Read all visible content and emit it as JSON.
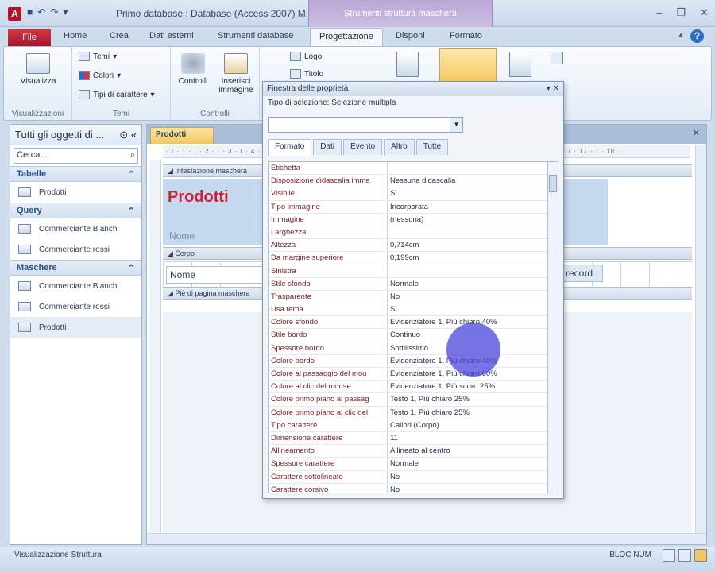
{
  "window": {
    "title": "Primo database : Database (Access 2007) M...",
    "tools_tab": "Strumenti struttura maschera"
  },
  "tabs": [
    {
      "label": "File"
    },
    {
      "label": "Home"
    },
    {
      "label": "Crea"
    },
    {
      "label": "Dati esterni"
    },
    {
      "label": "Strumenti database"
    },
    {
      "label": "Progettazione"
    },
    {
      "label": "Disponi"
    },
    {
      "label": "Formato"
    }
  ],
  "ribbon": {
    "visualizza": "Visualizza",
    "group_visualizzazioni": "Visualizzazioni",
    "temi": "Temi",
    "colori": "Colori",
    "tipi_carattere": "Tipi di carattere",
    "group_temi": "Temi",
    "controlli": "Controlli",
    "inserisci_immagine": "Inserisci immagine",
    "group_controlli": "Controlli",
    "logo": "Logo",
    "titolo": "Titolo"
  },
  "nav": {
    "header": "Tutti gli oggetti di ...",
    "search_placeholder": "Cerca...",
    "groups": [
      {
        "label": "Tabelle",
        "items": [
          "Prodotti"
        ]
      },
      {
        "label": "Query",
        "items": [
          "Commerciante Bianchi",
          "Commerciante rossi"
        ]
      },
      {
        "label": "Maschere",
        "items": [
          "Commerciante Bianchi",
          "Commerciante rossi",
          "Prodotti"
        ]
      }
    ]
  },
  "document": {
    "tab_label": "Prodotti",
    "header_section": "Intestazione maschera",
    "body_section": "Corpo",
    "footer_section": "Piè di pagina maschera",
    "form_title": "Prodotti",
    "header_field": "Nome",
    "body_field": "Nome",
    "record_button": "record"
  },
  "property_sheet": {
    "title": "Finestra delle proprietà",
    "selection_type": "Tipo di selezione:  Selezione multipla",
    "tabs": [
      "Formato",
      "Dati",
      "Evento",
      "Altro",
      "Tutte"
    ],
    "active_tab": "Formato",
    "rows": [
      [
        "Etichetta",
        ""
      ],
      [
        "Disposizione didascalia imma",
        "Nessuna didascalia"
      ],
      [
        "Visibile",
        "Sì"
      ],
      [
        "Tipo immagine",
        "Incorporata"
      ],
      [
        "Immagine",
        "(nessuna)"
      ],
      [
        "Larghezza",
        ""
      ],
      [
        "Altezza",
        "0,714cm"
      ],
      [
        "Da margine superiore",
        "0,199cm"
      ],
      [
        "Sinistra",
        ""
      ],
      [
        "Stile sfondo",
        "Normale"
      ],
      [
        "Trasparente",
        "No"
      ],
      [
        "Usa tema",
        "Sì"
      ],
      [
        "Colore sfondo",
        "Evidenziatore 1, Più chiaro 40%"
      ],
      [
        "Stile bordo",
        "Continuo"
      ],
      [
        "Spessore bordo",
        "Sottilissimo"
      ],
      [
        "Colore bordo",
        "Evidenziatore 1, Più chiaro 40%"
      ],
      [
        "Colore al passaggio del mou",
        "Evidenziatore 1, Più chiaro 60%"
      ],
      [
        "Colore al clic del mouse",
        "Evidenziatore 1, Più scuro 25%"
      ],
      [
        "Colore primo piano al passag",
        "Testo 1, Più chiaro 25%"
      ],
      [
        "Colore primo piano al clic del",
        "Testo 1, Più chiaro 25%"
      ],
      [
        "Tipo carattere",
        "Calibri (Corpo)"
      ],
      [
        "Dimensione carattere",
        "11"
      ],
      [
        "Allineamento",
        "Allineato al centro"
      ],
      [
        "Spessore carattere",
        "Normale"
      ],
      [
        "Carattere sottolineato",
        "No"
      ],
      [
        "Carattere corsivo",
        "No"
      ]
    ]
  },
  "status": {
    "left": "Visualizzazione Struttura",
    "right": "BLOC NUM"
  },
  "colors": {
    "accent": "#2e6dc4",
    "file_tab": "#b5122a",
    "form_title": "#d11f2f",
    "cursor_highlight": "#4c46dc"
  }
}
